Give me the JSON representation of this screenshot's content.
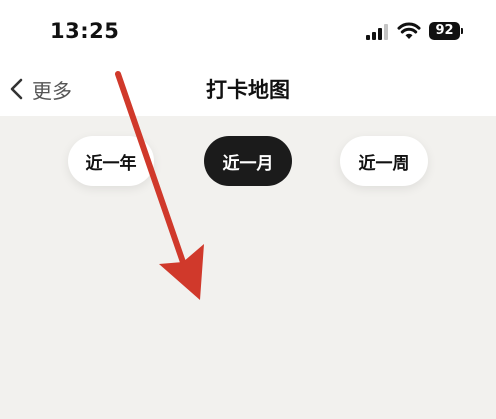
{
  "status_bar": {
    "time": "13:25",
    "battery": "92",
    "icons": [
      "signal-icon",
      "wifi-icon",
      "battery-icon"
    ]
  },
  "nav": {
    "back_label": "更多",
    "back_icon": "chevron-left-icon",
    "title": "打卡地图"
  },
  "filters": [
    {
      "label": "近一年",
      "selected": false
    },
    {
      "label": "近一月",
      "selected": true
    },
    {
      "label": "近一周",
      "selected": false
    }
  ],
  "colors": {
    "background": "#f2f1ee",
    "selected_pill": "#1b1b1b",
    "annotation_arrow": "#d0392b"
  }
}
